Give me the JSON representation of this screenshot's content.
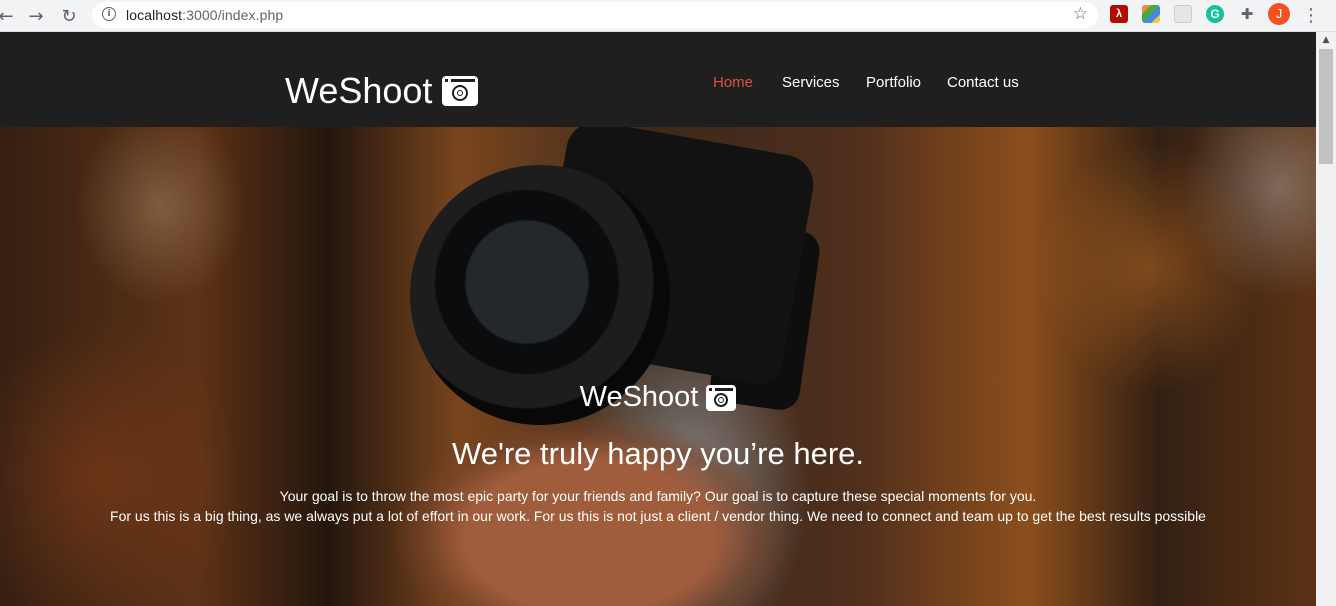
{
  "browser": {
    "back_icon": "←",
    "forward_icon": "→",
    "reload_icon": "↻",
    "info_icon": "i",
    "url_host": "localhost",
    "url_rest": ":3000/index.php",
    "star_icon": "☆",
    "ext_pdf_label": "λ",
    "ext_grammarly_label": "G",
    "ext_puzzle_icon": "✚",
    "profile_initial": "J",
    "menu_icon": "⋮"
  },
  "navbar": {
    "brand": "WeShoot",
    "menu": [
      {
        "label": "Home",
        "active": true
      },
      {
        "label": "Services",
        "active": false
      },
      {
        "label": "Portfolio",
        "active": false
      },
      {
        "label": "Contact us",
        "active": false
      }
    ]
  },
  "hero": {
    "brand": "WeShoot",
    "tagline": "We're truly happy you’re here.",
    "line1": "Your goal is to throw the most epic party for your friends and family? Our goal is to capture these special moments for you.",
    "line2": "For us this is a big thing, as we always put a lot of effort in our work. For us this is not just a client / vendor thing. We need to connect and team up to get the best results possible"
  },
  "colors": {
    "navbar_bg": "#1f1f1f",
    "active_link": "#e0513b",
    "text": "#ffffff"
  },
  "scrollbar": {
    "up_arrow": "▲"
  }
}
